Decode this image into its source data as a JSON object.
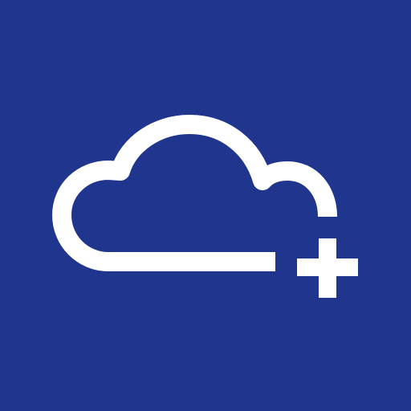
{
  "icon": {
    "name": "cloud-add-icon",
    "background_color": "#1f358e",
    "foreground_color": "#ffffff"
  }
}
